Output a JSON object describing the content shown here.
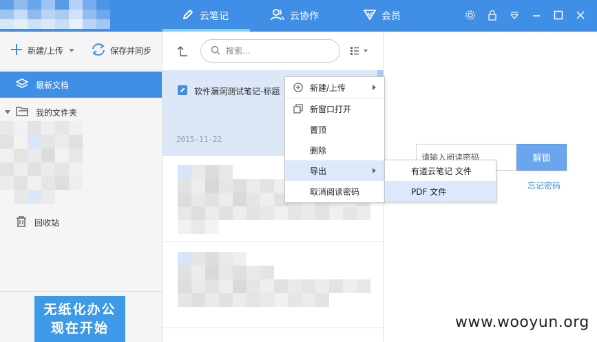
{
  "titlebar": {
    "tabs": [
      {
        "label": "云笔记",
        "icon": "pencil-icon",
        "active": true
      },
      {
        "label": "云协作",
        "icon": "users-icon",
        "active": false
      },
      {
        "label": "会员",
        "icon": "vip-icon",
        "active": false
      }
    ],
    "window_controls": [
      "gear-icon",
      "lock-icon",
      "dropdown-icon",
      "minimize-icon",
      "maximize-icon",
      "close-icon"
    ],
    "accent_color": "#3f8fe6"
  },
  "sidebar": {
    "new_upload_label": "新建/上传",
    "save_sync_label": "保存并同步",
    "items": [
      {
        "label": "最新文档",
        "icon": "layers-icon",
        "active": true
      },
      {
        "label": "我的文件夹",
        "icon": "folder-icon",
        "active": false
      },
      {
        "label": "回收站",
        "icon": "trash-icon",
        "active": false
      }
    ],
    "banner_line1": "无纸化办公",
    "banner_line2": "现在开始"
  },
  "notelist": {
    "search_placeholder": "搜索...",
    "selected_note": {
      "title": "软件漏洞测试笔记-标题",
      "date": "2015-11-22"
    }
  },
  "context_menu": {
    "items": [
      "新建/上传",
      "新窗口打开",
      "置顶",
      "删除",
      "导出",
      "取消阅读密码"
    ],
    "highlighted": "导出",
    "export_submenu": [
      "有道云笔记 文件",
      "PDF 文件"
    ]
  },
  "password_panel": {
    "placeholder": "请输入阅读密码",
    "unlock_label": "解锁",
    "forgot_label": "忘记密码"
  },
  "watermark": "www.wooyun.org"
}
